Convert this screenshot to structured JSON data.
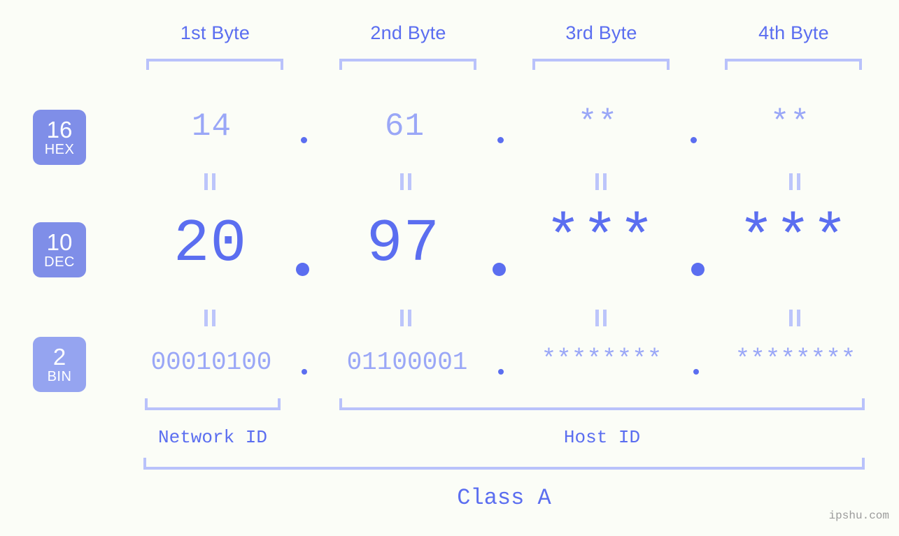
{
  "meta": {
    "watermark": "ipshu.com",
    "background_color": "#fbfdf7",
    "accent_color": "#5b6ef0",
    "accent_light_color": "#9aa7f7",
    "bracket_color": "#b9c2fb",
    "badge_color": "#7f8ee8",
    "badge_color_light": "#95a4f0"
  },
  "byte_headers": [
    {
      "label": "1st Byte"
    },
    {
      "label": "2nd Byte"
    },
    {
      "label": "3rd Byte"
    },
    {
      "label": "4th Byte"
    }
  ],
  "rows": [
    {
      "badge_number": "16",
      "badge_label": "HEX",
      "values": [
        "14",
        "61",
        "**",
        "**"
      ],
      "separators": [
        ".",
        ".",
        "."
      ]
    },
    {
      "badge_number": "10",
      "badge_label": "DEC",
      "values": [
        "20",
        "97",
        "***",
        "***"
      ],
      "separators": [
        ".",
        ".",
        "."
      ]
    },
    {
      "badge_number": "2",
      "badge_label": "BIN",
      "values": [
        "00010100",
        "01100001",
        "********",
        "********"
      ],
      "separators": [
        ".",
        ".",
        "."
      ]
    }
  ],
  "equality_marks": {
    "glyph": "=",
    "count_per_gap": 4,
    "gaps": 2
  },
  "footer": {
    "network_id_label": "Network ID",
    "host_id_label": "Host ID",
    "class_label": "Class A"
  }
}
